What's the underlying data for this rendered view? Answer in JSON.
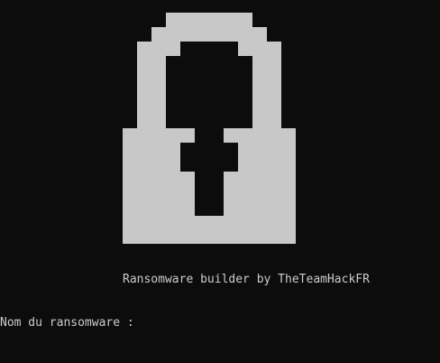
{
  "console": {
    "art": "padlock-icon",
    "banner": "Ransomware builder by TheTeamHackFR",
    "prompt_label": "Nom du ransomware :",
    "prompt_value": ""
  },
  "colors": {
    "background": "#0c0c0c",
    "foreground": "#cccccc"
  }
}
